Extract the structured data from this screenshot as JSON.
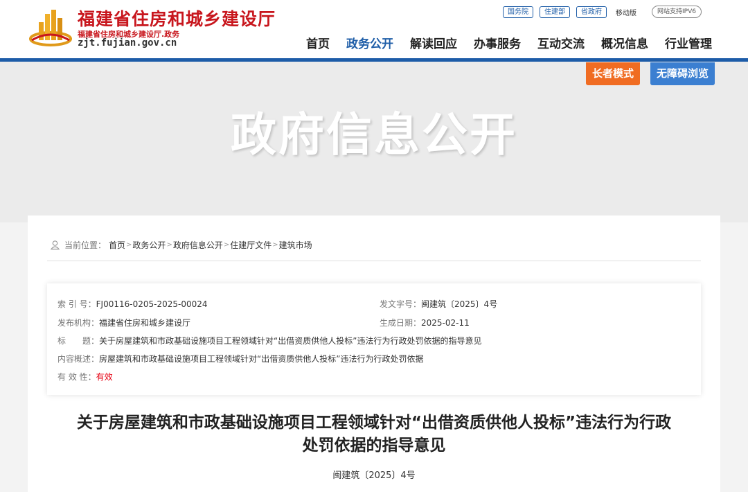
{
  "site": {
    "title": "福建省住房和城乡建设厅",
    "subtitle": "福建省住房和城乡建设厅.政务",
    "domain": "zjt.fujian.gov.cn",
    "logo_icon": "building-logo-icon"
  },
  "top_links": {
    "gov1": "国务院",
    "gov2": "住建部",
    "gov3": "省政府",
    "mobile": "移动版",
    "ipv6": "网站支持IPV6"
  },
  "nav": {
    "items": [
      "首页",
      "政务公开",
      "解读回应",
      "办事服务",
      "互动交流",
      "概况信息",
      "行业管理"
    ],
    "active_index": 1
  },
  "modes": {
    "elder": "长者模式",
    "accessible": "无障碍浏览"
  },
  "banner": {
    "title": "政府信息公开"
  },
  "breadcrumb": {
    "label": "当前位置：",
    "items": [
      "首页",
      "政务公开",
      "政府信息公开",
      "住建厅文件",
      "建筑市场"
    ],
    "separator": ">"
  },
  "meta": {
    "index_key": "索 引 号：",
    "index_val": "FJ00116-0205-2025-00024",
    "docno_key": "发文字号：",
    "docno_val": "闽建筑〔2025〕4号",
    "org_key": "发布机构：",
    "org_val": "福建省住房和城乡建设厅",
    "date_key": "生成日期：",
    "date_val": "2025-02-11",
    "title_key": "标　　题：",
    "title_val": "关于房屋建筑和市政基础设施项目工程领域针对“出借资质供他人投标”违法行为行政处罚依据的指导意见",
    "summary_key": "内容概述：",
    "summary_val": "房屋建筑和市政基础设施项目工程领域针对“出借资质供他人投标”违法行为行政处罚依据",
    "valid_key": "有 效 性：",
    "valid_val": "有效"
  },
  "document": {
    "title_line1": "关于房屋建筑和市政基础设施项目工程领域针对“出借资质供他人投标”违法行为行政",
    "title_line2": "处罚依据的指导意见",
    "number": "闽建筑〔2025〕4号"
  },
  "colors": {
    "brand_red": "#c8161d",
    "nav_blue": "#1f5ea8",
    "elder_orange": "#f06c22",
    "access_blue": "#3b7fd1",
    "valid_red": "#e60012"
  }
}
